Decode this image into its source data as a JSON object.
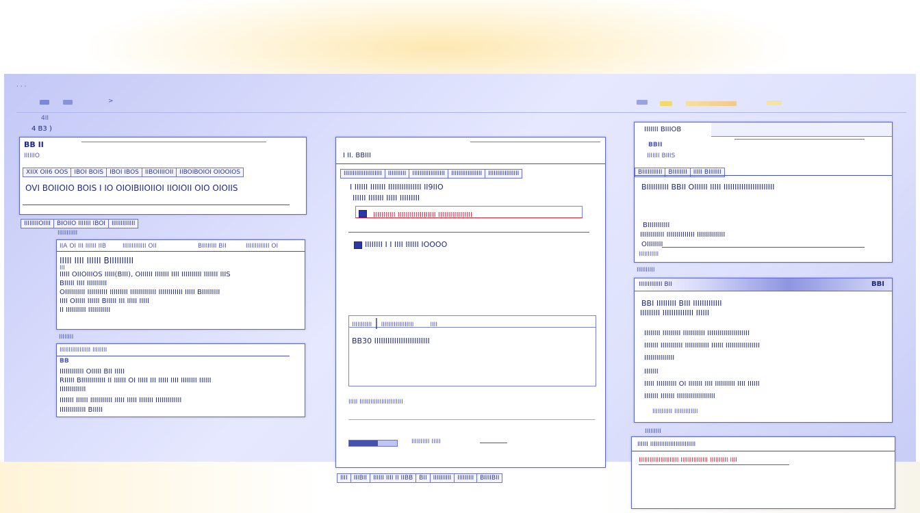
{
  "toolbar": {
    "nav": [
      "II",
      "II",
      ">"
    ],
    "right_label": "Ⅱ"
  },
  "left": {
    "mini_label_1": "4II",
    "mini_label_2": "4 B3 )",
    "panel_title": "BB II",
    "panel_subtitle": "IIIIIIO",
    "tabs": [
      "XIIX OII6 OOS",
      "IBOI BOIS",
      "IBOI IBOS",
      "IIBOIIIIOII",
      "IIBOIBOIOI OIOOIOS"
    ],
    "headline": "OVI BOIIOIO BOIS I IO OIOIBIIOIIOI IIOIOII OIO OIOIIS",
    "footer_tabs": [
      "IIIIIIIIOIIII",
      "BIOIIO IIIIIII IBOI",
      "IIIIIIIIIIIII"
    ],
    "section1_label": "IIIIIIIIIII",
    "box1_header": [
      "IIA OI III IIIIII IIB",
      "IIIIIIIIIIIII OII",
      "BIIIIIIII BII",
      "IIIIIIIIIIIII OI"
    ],
    "box1_lines": [
      "IIIII IIII IIIIII BIIIIIIIIII",
      "III",
      "IIIII OIIOIIIOS IIIII(BIII), OIIIIII IIIIIII IIII IIIIIIIIII IIIIIII IIIS",
      "BIIIII IIII IIIIIIIIII",
      "OIIIIIIIIII IIIIIIIIII IIIIIIIII IIIIIIIIIIIII IIIIIIIIIIII IIIII BIIIIIIIII",
      "IIII OIIIII IIIIII BIIIII III IIIII IIIII",
      "II IIIIIIIIII IIIIIIIIIII"
    ],
    "section2_label": "IIIIIIII",
    "box2_header": "IIIIIIIIIIIIIIIII IIIIIIII",
    "box2_lines": [
      "BB",
      "IIIIIIIIIIII OIIIII BII IIIII",
      "RIIIII BIIIIIIIIIIII II IIIIII OI IIIII III IIIII IIII IIIIIIII IIIIII",
      "IIIIIIIIIIIII",
      "IIIIIII IIIIII IIIIIIIIIII IIIII IIIII IIIIIII IIIIIIIIIIIII",
      "IIIIIIIIIIIII BIIIII"
    ]
  },
  "center": {
    "title": "I II. BBIII",
    "tabs": [
      "IIIIIIIIIIIIIIIIIIIII",
      "IIIIIIIIII",
      "IIIIIIIIIIIIIIIIII",
      "IIIIIIIIIIIIIIIII",
      "IIIIIIIIIIIIIIIII"
    ],
    "line1": "I IIIIII IIIIIII IIIIIIIIIIIIIII II9IIO",
    "line2": "IIIIII IIIIIII IIIII IIIIIIIII",
    "highlight": "IIIIIIIIIII IIIIIIIIIIIIIIIIIII IIIIIIIIIIIIIIIII",
    "entry": "IIIIIIII I I IIII IIIIII IOOOO",
    "sub_tabs": [
      "IIIIIIIIIII",
      "IIIIIIIIIIIIIIIIII",
      "IIII"
    ],
    "sub_body": "BB30 IIIIIIIIIIIIIIIIIIIIIIIII",
    "footer_line": "IIIII  IIIIIIIIIIIIIIIIIIIIIIII",
    "progress_label": "IIIIIIIIII IIIII",
    "progress": 0.6,
    "status_bar": [
      "IIII",
      "IIIBII",
      "IIIIII IIII II IIBB",
      "BII",
      "IIIIIIIIII",
      "IIIIIIIII",
      "BIIIIBII"
    ]
  },
  "right": {
    "title": "IIIIIII BIIIOB",
    "label_a": "BBII",
    "label_b": "IIIIIII BIIIS",
    "tabs": [
      "BIIIIIIIIIII",
      "BIIIIIIII",
      "IIIII BIIIIIII"
    ],
    "headline": "BIIIIIIIIII BBII OIIIIII IIIII IIIIIIIIIIIIIIIIIIIIIII",
    "lines": [
      "BIIIIIIIIIII",
      "IIIIIIIIIIII IIIIIIIIIIIIII IIIIIIIIIIIIII",
      "OIIIIIIII",
      "IIIIIIIIIII"
    ],
    "section_label": "IIIIIIIIII",
    "panel2_title": "IIIIIIIIIIIII BII",
    "panel2_badge": "BBI",
    "panel2_lines": [
      "BBI  IIIIIIIII   BIII IIIIIIIIIIIII",
      "IIIIIIIII IIIIIIIIIIIIII IIIIII",
      "IIIIIIII IIIIIIIII IIIIIIIIIII IIIIIIIIIIIIIIIIIIIII",
      "IIIIIII IIIIIIIIIII IIIIIIIIIIII IIIIII IIIIIIIIIIIIIIIII",
      "IIIIIIIIIIIIIII",
      "IIIIIII",
      "IIIII IIIIIIIIII OI IIIIIII IIII IIIIIIIIII IIII IIIIII",
      "IIIIIII IIIIIII IIIIIIIIIIIIIIIIIII",
      "IIIIIIIIIII IIIIIIIIIIIII"
    ],
    "section2_label": "IIIIIIIII",
    "panel3_header": "IIIIII IIIIIIIIIIIIIIIIIIIIIIIII",
    "panel3_red": "IIIIIIIIIIIIIIIIIIIIII IIIIIIIIIIIIIII IIIIIIIIII IIII"
  }
}
